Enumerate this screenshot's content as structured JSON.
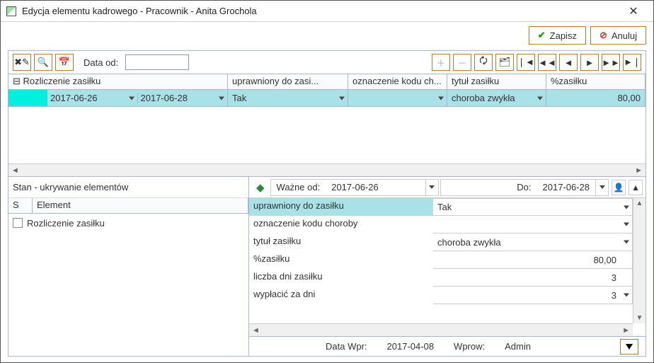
{
  "window": {
    "title": "Edycja elementu kadrowego - Pracownik - Anita Grochola"
  },
  "buttons": {
    "save": "Zapisz",
    "cancel": "Anuluj"
  },
  "toolbar": {
    "data_od_label": "Data od:",
    "data_od_value": ""
  },
  "grid": {
    "headers": {
      "col1": "Rozliczenie zasiłku",
      "col2": "uprawniony do zasi...",
      "col3": "oznaczenie kodu ch...",
      "col4": "tytuł zasiłku",
      "col5": "%zasiłku"
    },
    "row": {
      "date_from": "2017-06-26",
      "date_to": "2017-06-28",
      "uprawniony": "Tak",
      "kod": "",
      "tytul": "choroba zwykła",
      "procent": "80,00"
    }
  },
  "left_pane": {
    "title": "Stan - ukrywanie elementów",
    "col_s": "S",
    "col_element": "Element",
    "item1": "Rozliczenie zasiłku"
  },
  "right_pane": {
    "wazne_od_label": "Ważne od:",
    "wazne_od_value": "2017-06-26",
    "do_label": "Do:",
    "do_value": "2017-06-28",
    "properties": [
      {
        "label": "uprawniony do zasiłku",
        "value": "Tak",
        "align": "left",
        "selected": true,
        "dd": true
      },
      {
        "label": "oznaczenie kodu choroby",
        "value": "",
        "align": "left",
        "dd": true
      },
      {
        "label": "tytuł zasiłku",
        "value": "choroba zwykła",
        "align": "left",
        "dd": true
      },
      {
        "label": "%zasiłku",
        "value": "80,00",
        "align": "right"
      },
      {
        "label": "liczba dni zasiłku",
        "value": "3",
        "align": "right"
      },
      {
        "label": "wypłacić za dni",
        "value": "3",
        "align": "right",
        "dd": true
      }
    ]
  },
  "status": {
    "data_wpr_label": "Data Wpr:",
    "data_wpr_value": "2017-04-08",
    "wprow_label": "Wprow:",
    "wprow_value": "Admin"
  }
}
